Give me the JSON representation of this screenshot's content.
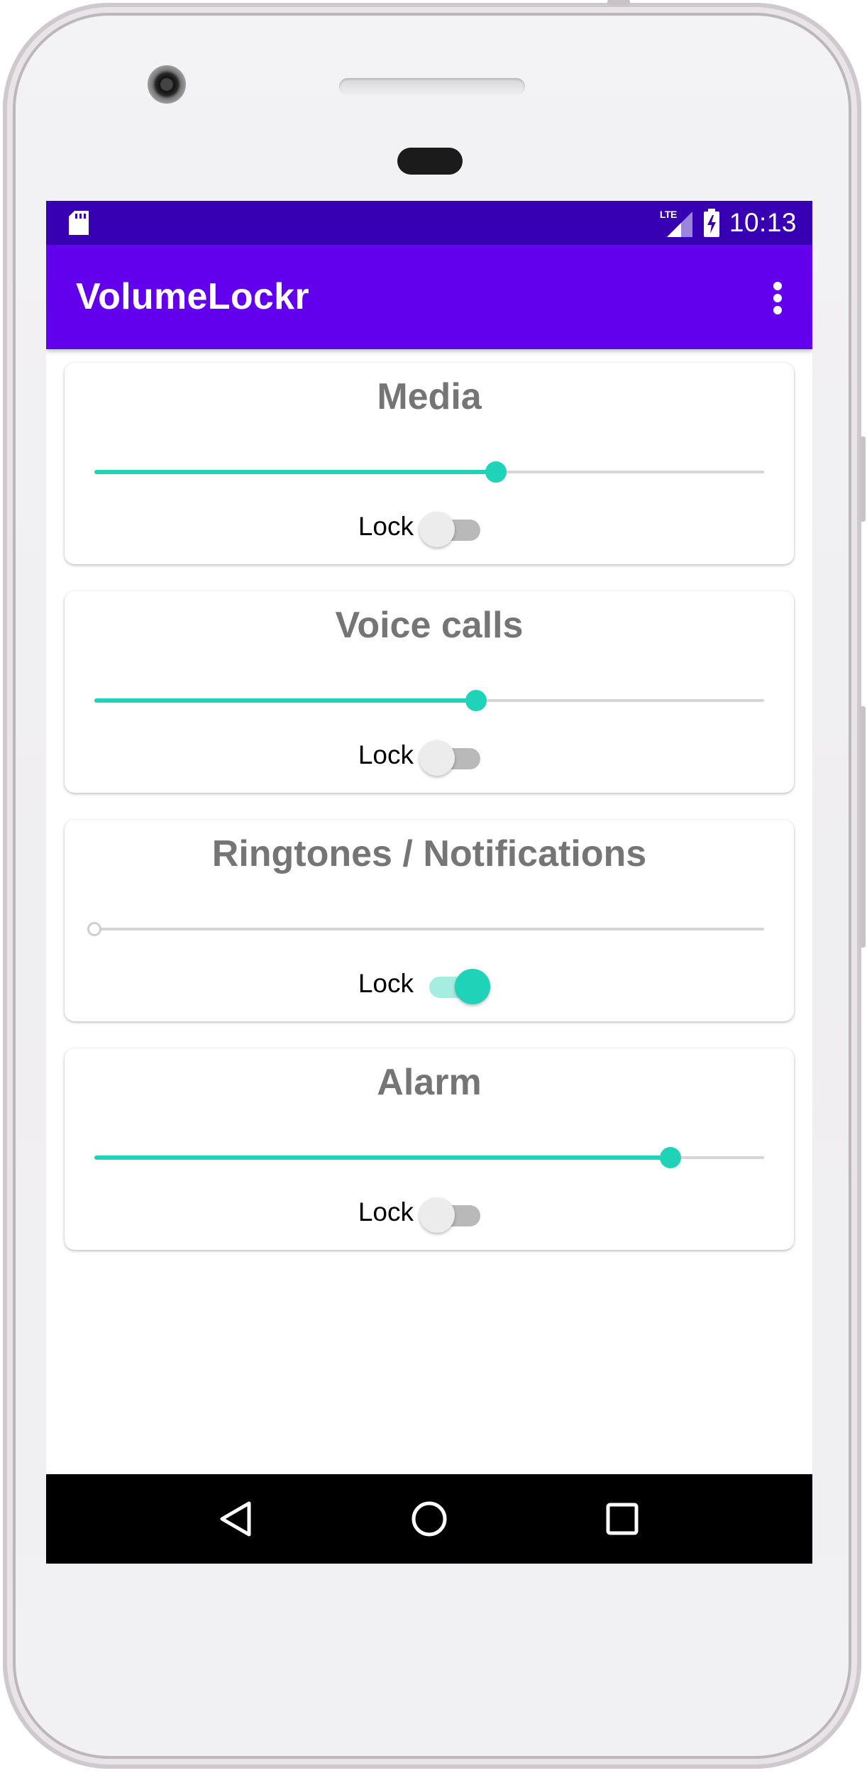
{
  "status_bar": {
    "network": "LTE",
    "time": "10:13"
  },
  "app_bar": {
    "title": "VolumeLockr",
    "overflow_icon": "more-vert-icon"
  },
  "volume_cards": [
    {
      "title": "Media",
      "level": 0.6,
      "lock_label": "Lock",
      "locked": false
    },
    {
      "title": "Voice calls",
      "level": 0.57,
      "lock_label": "Lock",
      "locked": false
    },
    {
      "title": "Ringtones / Notifications",
      "level": 0.0,
      "lock_label": "Lock",
      "locked": true
    },
    {
      "title": "Alarm",
      "level": 0.86,
      "lock_label": "Lock",
      "locked": false
    }
  ],
  "nav_bar": {
    "back_icon": "back-triangle-icon",
    "home_icon": "home-circle-icon",
    "recents_icon": "recents-square-icon"
  },
  "colors": {
    "status_bar": "#3700b3",
    "app_bar": "#6200ee",
    "accent": "#1ed3b8"
  }
}
